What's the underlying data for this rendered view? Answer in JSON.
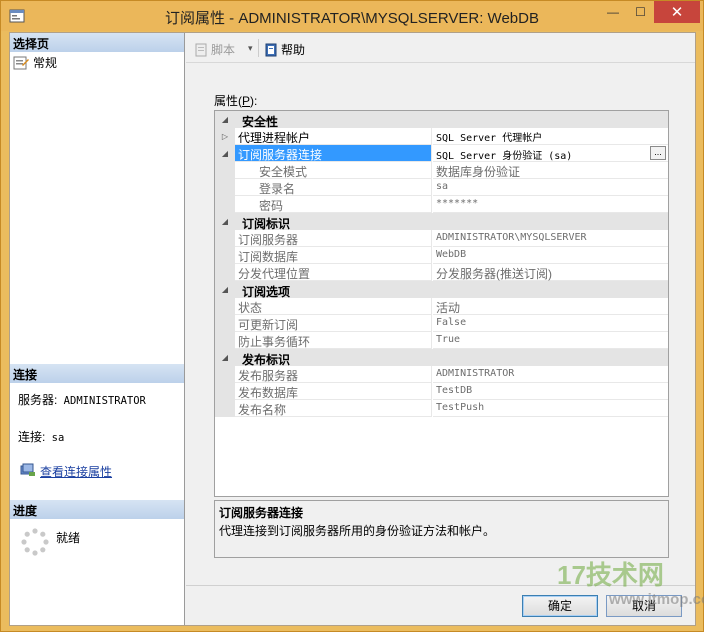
{
  "window": {
    "title": "订阅属性 - ADMINISTRATOR\\MYSQLSERVER: WebDB",
    "min_glyph": "—",
    "max_glyph": "☐",
    "close_glyph": "✕"
  },
  "left": {
    "select_page_header": "选择页",
    "pages": [
      {
        "label": "常规",
        "icon": "properties-page-icon"
      }
    ],
    "connection_header": "连接",
    "server_label": "服务器:",
    "server_value": "ADMINISTRATOR",
    "connection_label": "连接:",
    "connection_value": "sa",
    "view_connection_link": "查看连接属性",
    "progress_header": "进度",
    "progress_status": "就绪"
  },
  "toolbar": {
    "script_label": "脚本",
    "script_arrow": "▾",
    "help_label": "帮助"
  },
  "properties_label": "属性(P):",
  "properties_label_prefix": "属性(",
  "properties_label_hotkey": "P",
  "properties_label_suffix": "):",
  "grid": {
    "cat_security": "安全性",
    "agent_account_name": "代理进程帐户",
    "agent_account_value": "SQL Server 代理帐户",
    "subscriber_conn_name": "订阅服务器连接",
    "subscriber_conn_value": "SQL Server 身份验证 (sa)",
    "security_mode_name": "安全模式",
    "security_mode_value": "数据库身份验证",
    "login_name": "登录名",
    "login_value": "sa",
    "password_name": "密码",
    "password_value": "*******",
    "cat_sub_identity": "订阅标识",
    "subscriber_name": "订阅服务器",
    "subscriber_value": "ADMINISTRATOR\\MYSQLSERVER",
    "sub_db_name": "订阅数据库",
    "sub_db_value": "WebDB",
    "dist_agent_loc_name": "分发代理位置",
    "dist_agent_loc_value": "分发服务器(推送订阅)",
    "cat_sub_options": "订阅选项",
    "state_name": "状态",
    "state_value": "活动",
    "updatable_name": "可更新订阅",
    "updatable_value": "False",
    "loop_name": "防止事务循环",
    "loop_value": "True",
    "cat_pub_identity": "发布标识",
    "publisher_name": "发布服务器",
    "publisher_value": "ADMINISTRATOR",
    "pub_db_name": "发布数据库",
    "pub_db_value": "TestDB",
    "pub_name_name": "发布名称",
    "pub_name_value": "TestPush",
    "ellipsis": "..."
  },
  "description": {
    "title": "订阅服务器连接",
    "text": "代理连接到订阅服务器所用的身份验证方法和帐户。"
  },
  "buttons": {
    "ok": "确定",
    "cancel": "取消"
  },
  "watermark": {
    "logo": "17技术网",
    "site": "www.itmop.com"
  }
}
